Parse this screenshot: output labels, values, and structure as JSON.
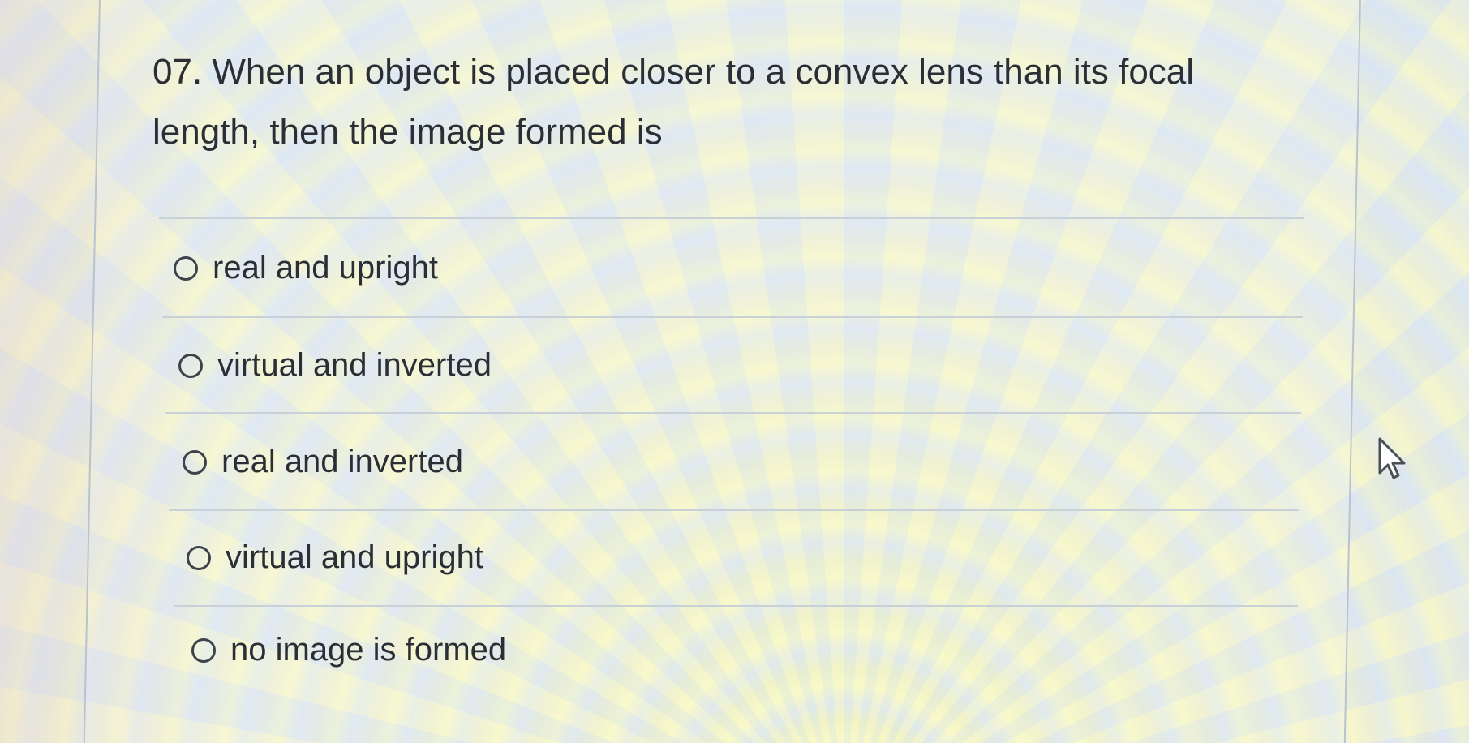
{
  "question": {
    "text": "07. When an object is placed closer to a convex lens than its focal length, then the image formed is"
  },
  "options": [
    {
      "label": "real and upright",
      "selected": false
    },
    {
      "label": "virtual and inverted",
      "selected": false
    },
    {
      "label": "real and inverted",
      "selected": false
    },
    {
      "label": "virtual and upright",
      "selected": false
    },
    {
      "label": "no image is formed",
      "selected": false
    }
  ],
  "icons": {
    "radio": "radio-button-icon",
    "cursor": "mouse-pointer-icon"
  },
  "colors": {
    "text": "#2b2f35",
    "separator": "#c9d1d8",
    "card_border": "#b9c2cf"
  }
}
